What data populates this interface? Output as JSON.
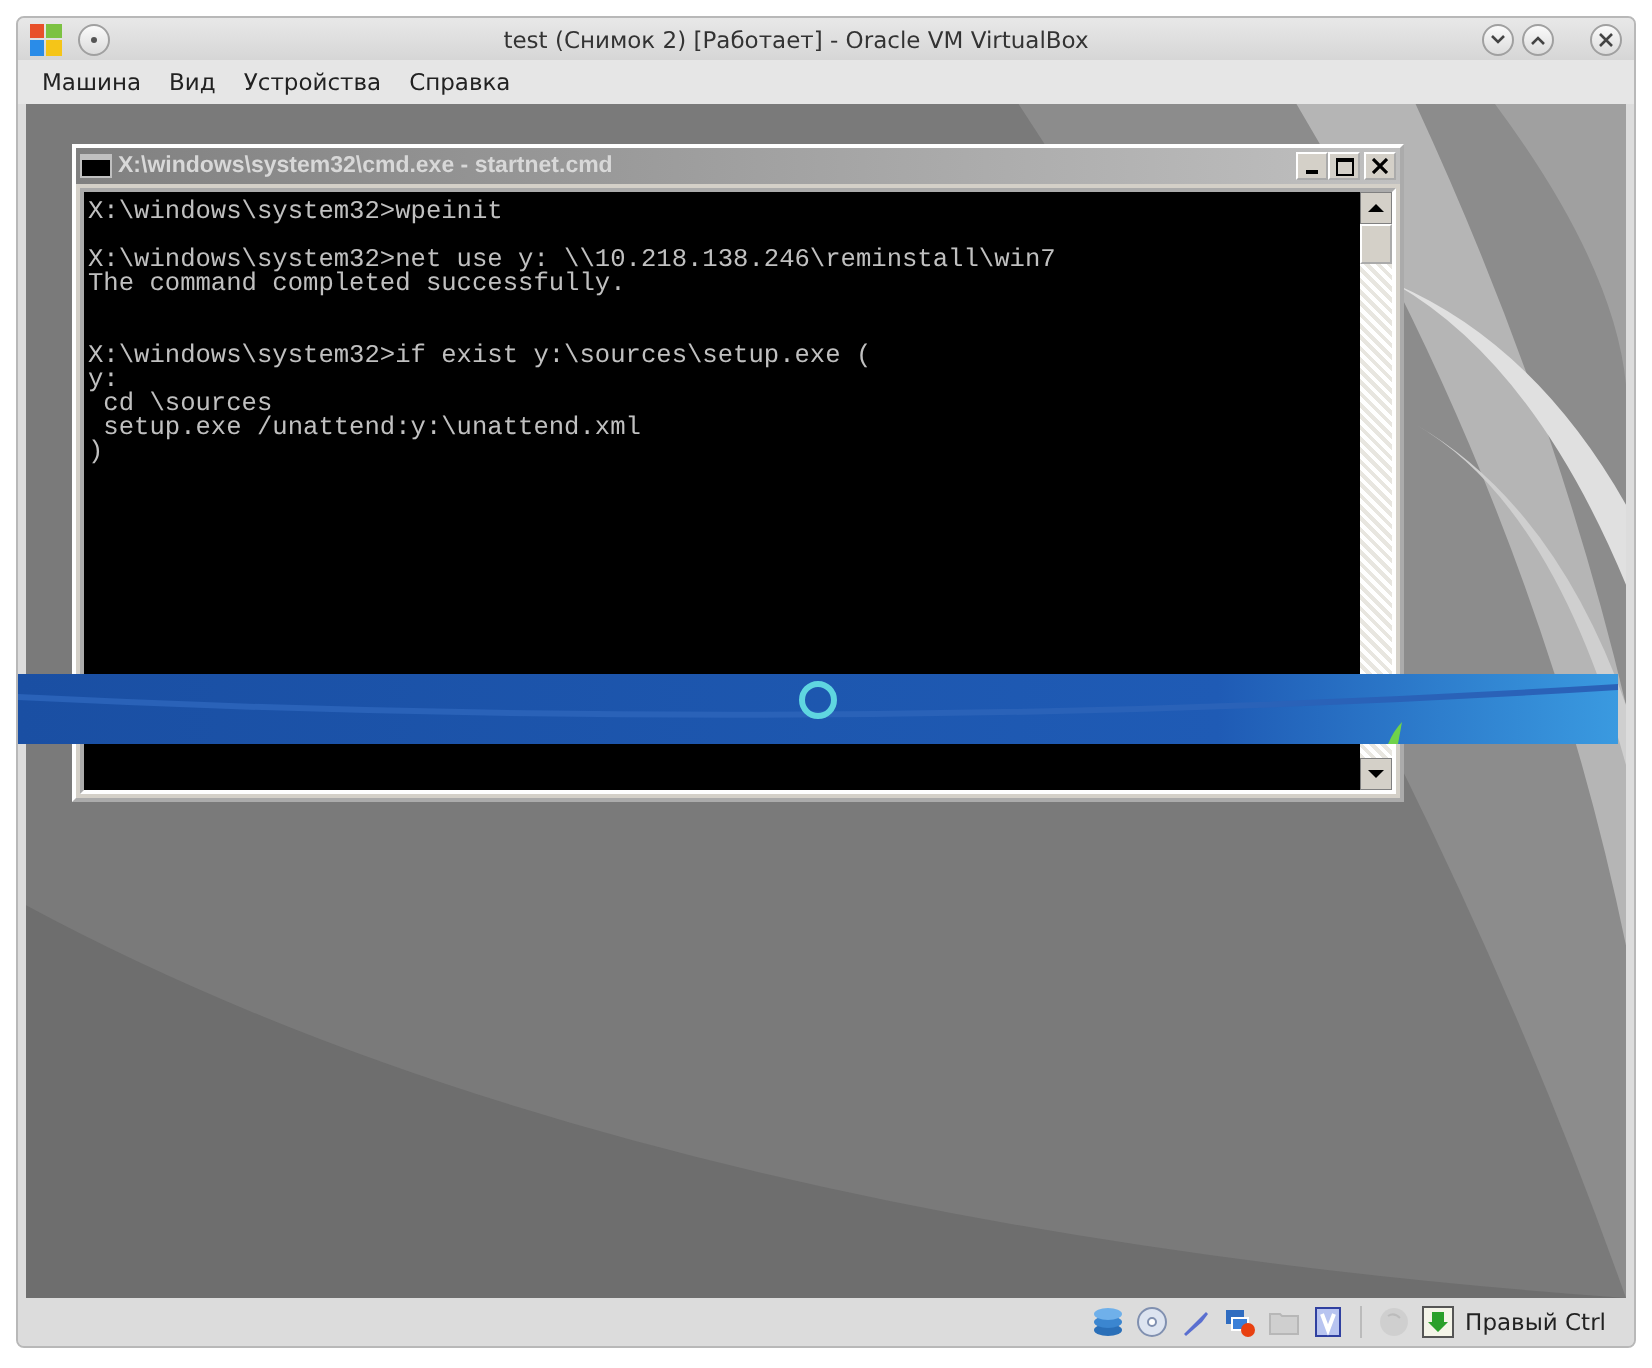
{
  "window": {
    "title": "test (Снимок 2) [Работает] - Oracle VM VirtualBox"
  },
  "menu": [
    "Машина",
    "Вид",
    "Устройства",
    "Справка"
  ],
  "console": {
    "title": "X:\\windows\\system32\\cmd.exe - startnet.cmd",
    "blocks": [
      [
        {
          "kind": "prompt",
          "text": "X:\\windows\\system32>wpeinit"
        }
      ],
      [
        {
          "kind": "prompt",
          "text": "X:\\windows\\system32>net use y: \\\\10.218.138.246\\reminstall\\win7"
        },
        {
          "kind": "output",
          "text": "The command completed successfully."
        }
      ],
      [
        {
          "kind": "prompt",
          "text": "X:\\windows\\system32>if exist y:\\sources\\setup.exe ("
        },
        {
          "kind": "prompt",
          "text": "y:"
        },
        {
          "kind": "prompt",
          "text": " cd \\sources"
        },
        {
          "kind": "prompt",
          "text": " setup.exe /unattend:y:\\unattend.xml"
        },
        {
          "kind": "prompt",
          "text": ")"
        }
      ]
    ]
  },
  "status_bar": {
    "devices": [
      {
        "kind": "disk",
        "disabled": false
      },
      {
        "kind": "cd",
        "disabled": false
      },
      {
        "kind": "usb",
        "disabled": false
      },
      {
        "kind": "network",
        "disabled": false
      },
      {
        "kind": "folder",
        "disabled": true
      },
      {
        "kind": "vt",
        "disabled": false
      },
      {
        "kind": "mouse",
        "disabled": true
      }
    ],
    "host_key": "Правый Ctrl"
  }
}
